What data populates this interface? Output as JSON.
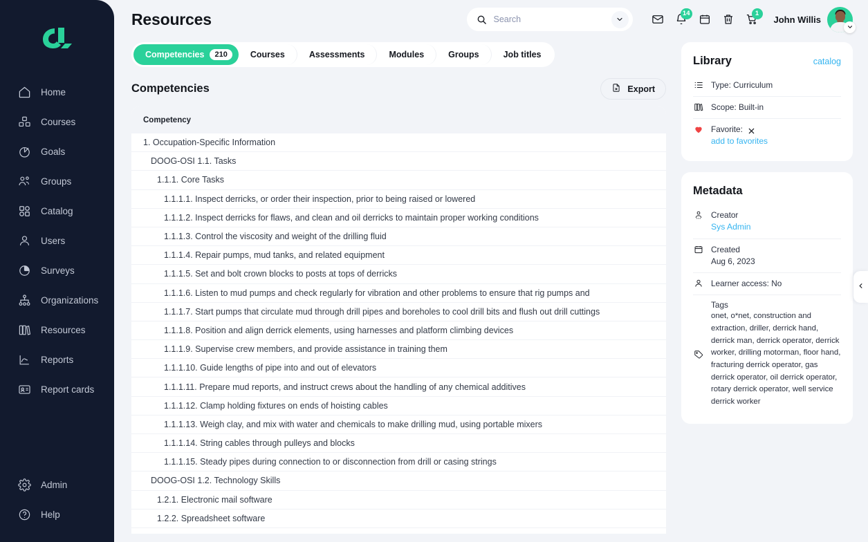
{
  "sidebar": {
    "logo_name": "cl-logo",
    "items": [
      {
        "label": "Home",
        "icon": "home-icon"
      },
      {
        "label": "Courses",
        "icon": "courses-icon"
      },
      {
        "label": "Goals",
        "icon": "goals-icon"
      },
      {
        "label": "Groups",
        "icon": "groups-icon"
      },
      {
        "label": "Catalog",
        "icon": "catalog-icon"
      },
      {
        "label": "Users",
        "icon": "users-icon"
      },
      {
        "label": "Surveys",
        "icon": "surveys-icon"
      },
      {
        "label": "Organizations",
        "icon": "organizations-icon"
      },
      {
        "label": "Resources",
        "icon": "resources-icon"
      },
      {
        "label": "Reports",
        "icon": "reports-icon"
      },
      {
        "label": "Report cards",
        "icon": "report-cards-icon"
      }
    ],
    "bottom_items": [
      {
        "label": "Admin",
        "icon": "gear-icon"
      },
      {
        "label": "Help",
        "icon": "help-icon"
      }
    ]
  },
  "header": {
    "title": "Resources",
    "search": {
      "value": "",
      "placeholder": "Search"
    },
    "icons": [
      {
        "name": "mail-icon",
        "badge": ""
      },
      {
        "name": "bell-icon",
        "badge": "14"
      },
      {
        "name": "calendar-icon",
        "badge": ""
      },
      {
        "name": "trash-icon",
        "badge": ""
      },
      {
        "name": "cart-icon",
        "badge": "1"
      }
    ],
    "user_name": "John Willis"
  },
  "tabs": [
    {
      "label": "Competencies",
      "count": "210",
      "active": true
    },
    {
      "label": "Courses",
      "count": "",
      "active": false
    },
    {
      "label": "Assessments",
      "count": "",
      "active": false
    },
    {
      "label": "Modules",
      "count": "",
      "active": false
    },
    {
      "label": "Groups",
      "count": "",
      "active": false
    },
    {
      "label": "Job titles",
      "count": "",
      "active": false
    }
  ],
  "section": {
    "title": "Competencies",
    "export_label": "Export"
  },
  "table": {
    "column_header": "Competency",
    "rows": [
      {
        "level": 1,
        "text": "1. Occupation-Specific Information"
      },
      {
        "level": 2,
        "text": "DOOG-OSI 1.1. Tasks"
      },
      {
        "level": 3,
        "text": "1.1.1. Core Tasks"
      },
      {
        "level": 4,
        "text": "1.1.1.1. Inspect derricks, or order their inspection, prior to being raised or lowered"
      },
      {
        "level": 4,
        "text": "1.1.1.2. Inspect derricks for flaws, and clean and oil derricks to maintain proper working conditions"
      },
      {
        "level": 4,
        "text": "1.1.1.3. Control the viscosity and weight of the drilling fluid"
      },
      {
        "level": 4,
        "text": "1.1.1.4. Repair pumps, mud tanks, and related equipment"
      },
      {
        "level": 4,
        "text": "1.1.1.5. Set and bolt crown blocks to posts at tops of derricks"
      },
      {
        "level": 4,
        "text": "1.1.1.6. Listen to mud pumps and check regularly for vibration and other problems to ensure that rig pumps and"
      },
      {
        "level": 4,
        "text": "1.1.1.7. Start pumps that circulate mud through drill pipes and boreholes to cool drill bits and flush out drill cuttings"
      },
      {
        "level": 4,
        "text": "1.1.1.8. Position and align derrick elements, using harnesses and platform climbing devices"
      },
      {
        "level": 4,
        "text": "1.1.1.9. Supervise crew members, and provide assistance in training them"
      },
      {
        "level": 4,
        "text": "1.1.1.10. Guide lengths of pipe into and out of elevators"
      },
      {
        "level": 4,
        "text": "1.1.1.11. Prepare mud reports, and instruct crews about the handling of any chemical additives"
      },
      {
        "level": 4,
        "text": "1.1.1.12. Clamp holding fixtures on ends of hoisting cables"
      },
      {
        "level": 4,
        "text": "1.1.1.13. Weigh clay, and mix with water and chemicals to make drilling mud, using portable mixers"
      },
      {
        "level": 4,
        "text": "1.1.1.14. String cables through pulleys and blocks"
      },
      {
        "level": 4,
        "text": "1.1.1.15. Steady pipes during connection to or disconnection from drill or casing strings"
      },
      {
        "level": 2,
        "text": "DOOG-OSI 1.2. Technology Skills"
      },
      {
        "level": 3,
        "text": "1.2.1. Electronic mail software"
      },
      {
        "level": 3,
        "text": "1.2.2. Spreadsheet software"
      }
    ]
  },
  "library": {
    "title": "Library",
    "catalog_link": "catalog",
    "type": "Type: Curriculum",
    "scope": "Scope: Built-in",
    "favorite_label": "Favorite:",
    "add_to_favorites": "add to favorites"
  },
  "metadata": {
    "title": "Metadata",
    "creator_label": "Creator",
    "creator_value": "Sys Admin",
    "created_label": "Created",
    "created_value": "Aug 6, 2023",
    "learner_access": "Learner access: No",
    "tags_label": "Tags",
    "tags_value": "onet, o*net, construction and extraction, driller, derrick hand, derrick man, derrick operator, derrick worker, drilling motorman, floor hand, fracturing derrick operator, gas derrick operator, oil derrick operator, rotary derrick operator, well service derrick worker"
  },
  "colors": {
    "accent": "#2ad19a",
    "sidebar_bg": "#121a2e",
    "link": "#34b4f0",
    "page_bg": "#f2f4f8",
    "favorite_heart": "#ef4444"
  }
}
